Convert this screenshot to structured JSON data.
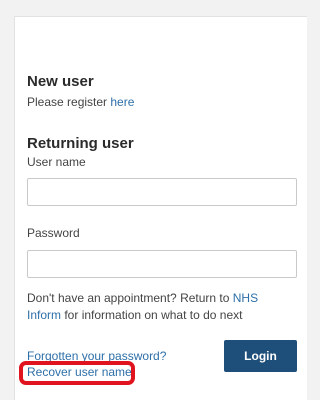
{
  "new_user": {
    "heading": "New user",
    "prompt": "Please register ",
    "link": "here"
  },
  "returning_user": {
    "heading": "Returning user",
    "username_label": "User name",
    "username_value": "",
    "password_label": "Password",
    "password_value": ""
  },
  "info": {
    "prefix": "Don't have an appointment? Return to ",
    "link": "NHS Inform",
    "suffix": " for information on what to do next"
  },
  "actions": {
    "forgot_password": "Forgotten your password?",
    "recover_username": "Recover user name",
    "login_label": "Login"
  },
  "colors": {
    "link": "#2e6fa8",
    "button": "#1e4f7a",
    "annotation": "#e0141e"
  }
}
